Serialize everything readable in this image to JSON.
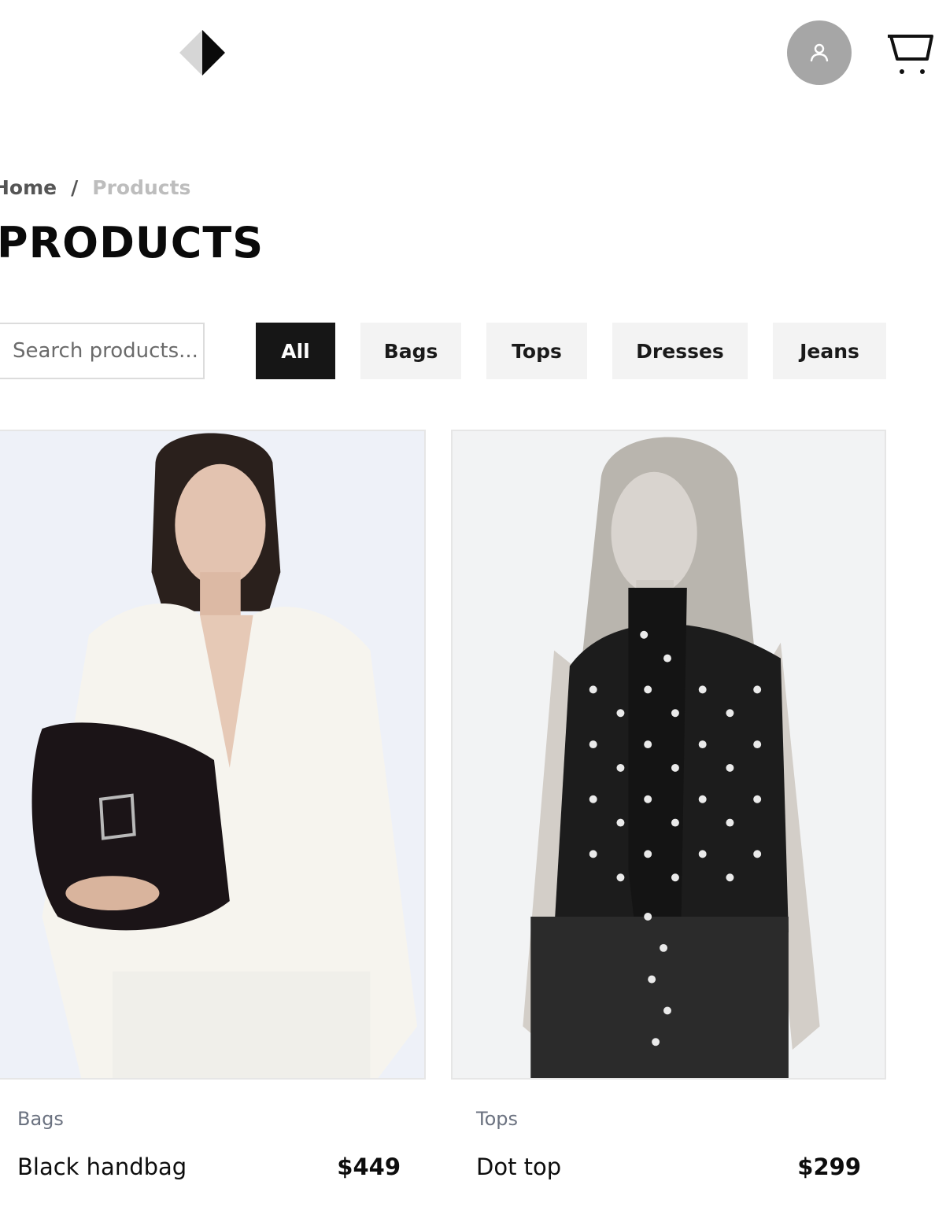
{
  "header": {
    "logo_icon": "diamond-logo-icon",
    "account_icon": "user-icon",
    "cart_icon": "shopping-cart-icon",
    "account_bg": "#a6a6a6"
  },
  "breadcrumb": {
    "home": "Home",
    "separator": "/",
    "current": "Products"
  },
  "page_title": "PRODUCTS",
  "search": {
    "placeholder": "Search products...",
    "value": ""
  },
  "filters": [
    {
      "label": "All",
      "active": true
    },
    {
      "label": "Bags",
      "active": false
    },
    {
      "label": "Tops",
      "active": false
    },
    {
      "label": "Dresses",
      "active": false
    },
    {
      "label": "Jeans",
      "active": false
    }
  ],
  "products": [
    {
      "category": "Bags",
      "name": "Black handbag",
      "price": "$449"
    },
    {
      "category": "Tops",
      "name": "Dot top",
      "price": "$299"
    }
  ],
  "colors": {
    "active_filter_bg": "#161616",
    "filter_bg": "#f3f3f3",
    "category_text": "#6b7280"
  }
}
